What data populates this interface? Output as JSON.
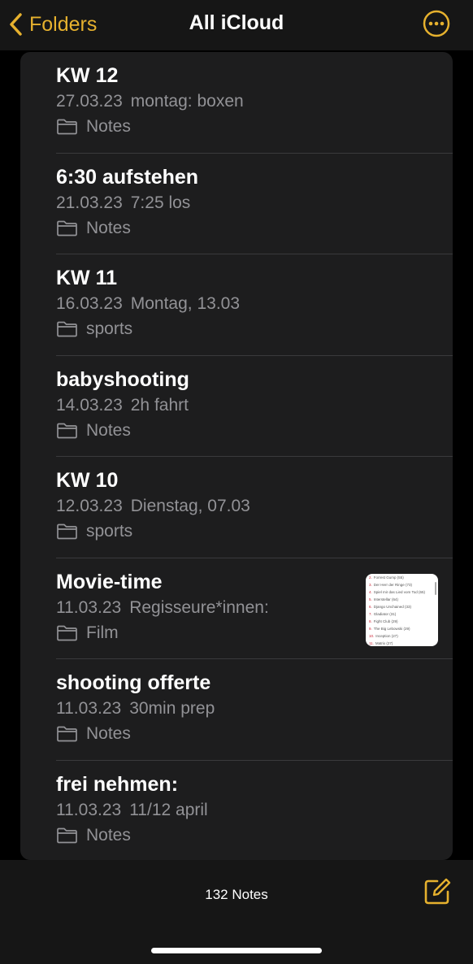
{
  "nav": {
    "back_label": "Folders",
    "title": "All iCloud",
    "accent_color": "#e6b12e",
    "back_icon": "chevron-left-icon",
    "more_icon": "ellipsis-circle-icon"
  },
  "notes": [
    {
      "title": "KW 12",
      "date": "27.03.23",
      "preview": "montag: boxen",
      "folder": "Notes",
      "has_thumbnail": false
    },
    {
      "title": "6:30 aufstehen",
      "date": "21.03.23",
      "preview": "7:25 los",
      "folder": "Notes",
      "has_thumbnail": false
    },
    {
      "title": "KW 11",
      "date": "16.03.23",
      "preview": "Montag, 13.03",
      "folder": "sports",
      "has_thumbnail": false
    },
    {
      "title": "babyshooting",
      "date": "14.03.23",
      "preview": "2h fahrt",
      "folder": "Notes",
      "has_thumbnail": false
    },
    {
      "title": "KW 10",
      "date": "12.03.23",
      "preview": "Dienstag, 07.03",
      "folder": "sports",
      "has_thumbnail": false
    },
    {
      "title": "Movie-time",
      "date": "11.03.23",
      "preview": "Regisseure*innen:",
      "folder": "Film",
      "has_thumbnail": true
    },
    {
      "title": "shooting offerte",
      "date": "11.03.23",
      "preview": "30min prep",
      "folder": "Notes",
      "has_thumbnail": false
    },
    {
      "title": "frei nehmen:",
      "date": "11.03.23",
      "preview": "11/12 april",
      "folder": "Notes",
      "has_thumbnail": false
    }
  ],
  "thumbnail_lines": [
    {
      "num": "2.",
      "text": "Forrest Gump (55)"
    },
    {
      "num": "3.",
      "text": "Der Herr der Ringe (73)"
    },
    {
      "num": "4.",
      "text": "Spiel mir das Lied vom Tod (65)"
    },
    {
      "num": "5.",
      "text": "Interstellar (64)"
    },
    {
      "num": "6.",
      "text": "Django Unchained (33)"
    },
    {
      "num": "7.",
      "text": "Gladiator (31)"
    },
    {
      "num": "8.",
      "text": "Fight Club (29)"
    },
    {
      "num": "9.",
      "text": "The Big Lebowski (29)"
    },
    {
      "num": "10.",
      "text": "Inception (27)"
    },
    {
      "num": "11.",
      "text": "Matrix (27)"
    },
    {
      "num": "12.",
      "text": "Batman – The Dark Knight (24)"
    }
  ],
  "toolbar": {
    "count_label": "132 Notes",
    "compose_icon": "compose-icon"
  }
}
